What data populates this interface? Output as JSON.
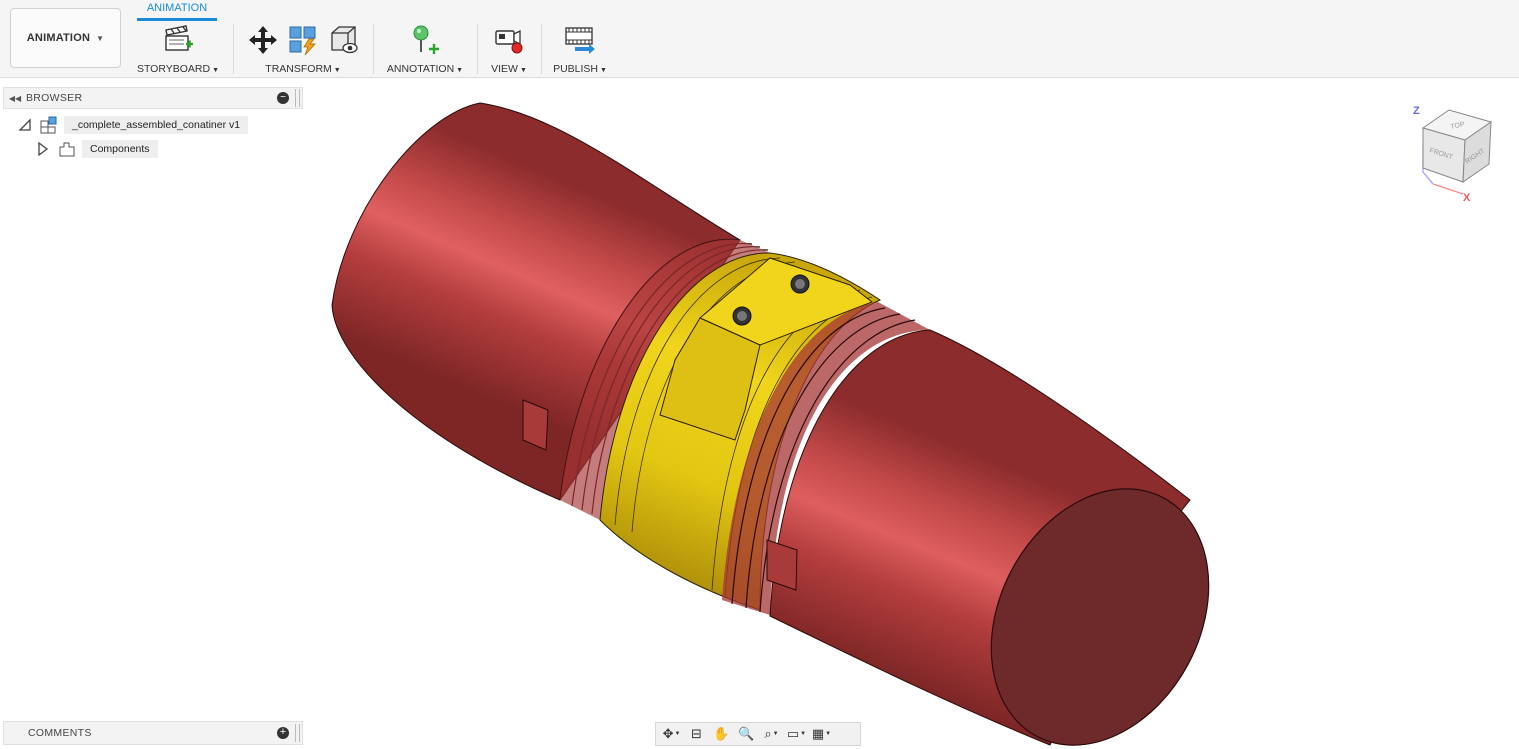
{
  "toolbar": {
    "workspace_label": "ANIMATION",
    "active_tab": "ANIMATION",
    "groups": [
      {
        "label": "STORYBOARD"
      },
      {
        "label": "TRANSFORM"
      },
      {
        "label": "ANNOTATION"
      },
      {
        "label": "VIEW"
      },
      {
        "label": "PUBLISH"
      }
    ]
  },
  "browser": {
    "title": "BROWSER",
    "root": "_complete_assembled_conatiner v1",
    "children": [
      "Components"
    ]
  },
  "comments": {
    "title": "COMMENTS"
  },
  "viewcube": {
    "top": "TOP",
    "front": "FRONT",
    "right": "RIGHT",
    "axis_z": "Z",
    "axis_x": "X"
  },
  "colors": {
    "accent": "#1a8ad6",
    "cylinder": "#b83a3a",
    "coupling": "#e6cc1a",
    "end_cap": "#6e2a2a"
  },
  "icons": {
    "storyboard": "new-storyboard-icon",
    "transform": [
      "move-icon",
      "auto-explode-icon",
      "toggle-visibility-icon"
    ],
    "annotation": "pin-annotation-icon",
    "view": "record-icon",
    "publish": "publish-video-icon"
  }
}
